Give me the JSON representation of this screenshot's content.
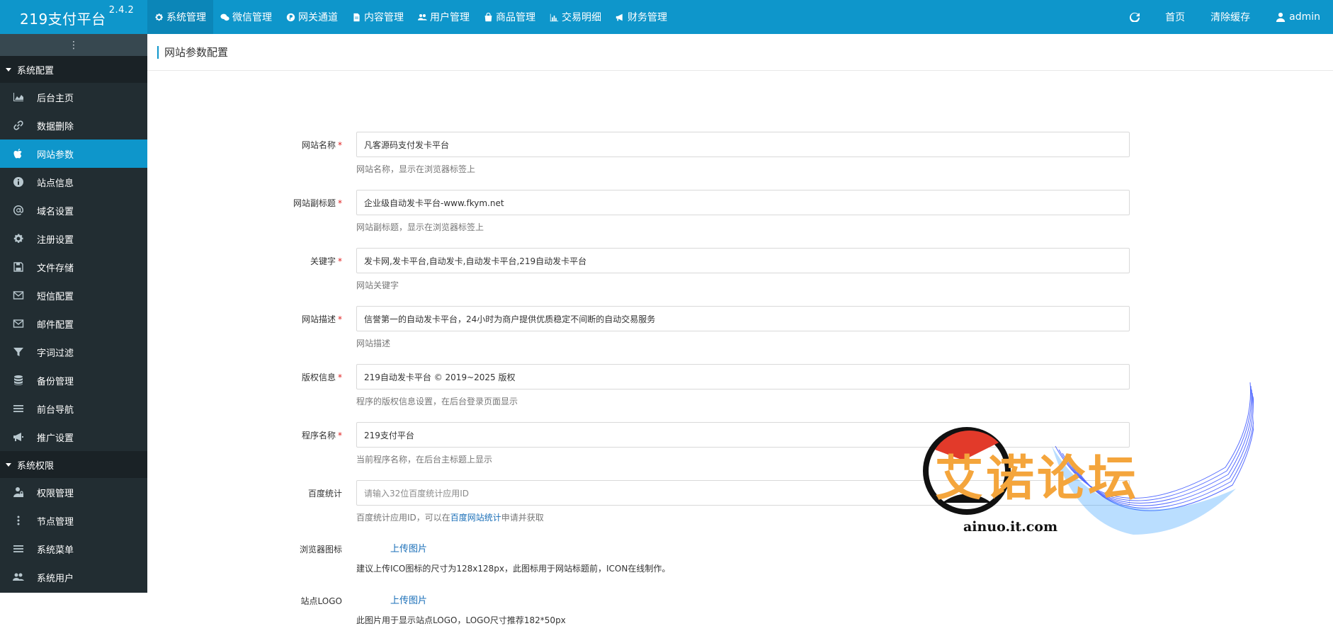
{
  "brand": {
    "name": "219支付平台",
    "version": "2.4.2"
  },
  "topnav": [
    {
      "label": "系统管理",
      "icon": "gear-icon",
      "active": true
    },
    {
      "label": "微信管理",
      "icon": "wechat-icon"
    },
    {
      "label": "网关通道",
      "icon": "p-circle-icon"
    },
    {
      "label": "内容管理",
      "icon": "document-icon"
    },
    {
      "label": "用户管理",
      "icon": "users-icon"
    },
    {
      "label": "商品管理",
      "icon": "shopping-bag-icon"
    },
    {
      "label": "交易明细",
      "icon": "bar-chart-icon"
    },
    {
      "label": "财务管理",
      "icon": "megaphone-icon"
    }
  ],
  "topright": {
    "refresh_icon": "refresh-icon",
    "home": "首页",
    "clear_cache": "清除缓存",
    "user": "admin"
  },
  "sidebar": {
    "toggle": "⋮",
    "group1": "系统配置",
    "items1": [
      {
        "label": "后台主页",
        "icon": "area-chart-icon"
      },
      {
        "label": "数据删除",
        "icon": "link-icon"
      },
      {
        "label": "网站参数",
        "icon": "apple-icon",
        "active": true
      },
      {
        "label": "站点信息",
        "icon": "info-icon"
      },
      {
        "label": "域名设置",
        "icon": "at-icon"
      },
      {
        "label": "注册设置",
        "icon": "gear-icon"
      },
      {
        "label": "文件存储",
        "icon": "floppy-icon"
      },
      {
        "label": "短信配置",
        "icon": "envelope-icon"
      },
      {
        "label": "邮件配置",
        "icon": "envelope-icon"
      },
      {
        "label": "字词过滤",
        "icon": "filter-icon"
      },
      {
        "label": "备份管理",
        "icon": "database-icon"
      },
      {
        "label": "前台导航",
        "icon": "menu-icon"
      },
      {
        "label": "推广设置",
        "icon": "bullhorn-icon"
      }
    ],
    "group2": "系统权限",
    "items2": [
      {
        "label": "权限管理",
        "icon": "user-lock-icon"
      },
      {
        "label": "节点管理",
        "icon": "ellipsis-vertical-icon"
      },
      {
        "label": "系统菜单",
        "icon": "menu-icon"
      },
      {
        "label": "系统用户",
        "icon": "users-icon"
      }
    ]
  },
  "page": {
    "title": "网站参数配置"
  },
  "form": {
    "site_name": {
      "label": "网站名称",
      "required": "*",
      "value": "凡客源码支付发卡平台",
      "help": "网站名称，显示在浏览器标签上"
    },
    "subtitle": {
      "label": "网站副标题",
      "required": "*",
      "value": "企业级自动发卡平台-www.fkym.net",
      "help": "网站副标题，显示在浏览器标签上"
    },
    "keywords": {
      "label": "关键字",
      "required": "*",
      "value": "发卡网,发卡平台,自动发卡,自动发卡平台,219自动发卡平台",
      "help": "网站关键字"
    },
    "description": {
      "label": "网站描述",
      "required": "*",
      "value": "信誉第一的自动发卡平台，24小时为商户提供优质稳定不间断的自动交易服务",
      "help": "网站描述"
    },
    "copyright": {
      "label": "版权信息",
      "required": "*",
      "value": "219自动发卡平台 © 2019~2025 版权",
      "help": "程序的版权信息设置，在后台登录页面显示"
    },
    "program_name": {
      "label": "程序名称",
      "required": "*",
      "value": "219支付平台",
      "help": "当前程序名称，在后台主标题上显示"
    },
    "baidu": {
      "label": "百度统计",
      "placeholder": "请输入32位百度统计应用ID",
      "help_prefix": "百度统计应用ID，可以在",
      "help_link": "百度网站统计",
      "help_suffix": "申请并获取"
    },
    "favicon": {
      "label": "浏览器图标",
      "upload": "上传图片",
      "help": "建议上传ICO图标的尺寸为128x128px，此图标用于网站标题前，ICON在线制作。"
    },
    "logo": {
      "label": "站点LOGO",
      "upload": "上传图片",
      "help": "此图片用于显示站点LOGO，LOGO尺寸推荐182*50px"
    }
  },
  "watermark": {
    "text": "艾诺论坛",
    "url": "ainuo.it.com"
  }
}
